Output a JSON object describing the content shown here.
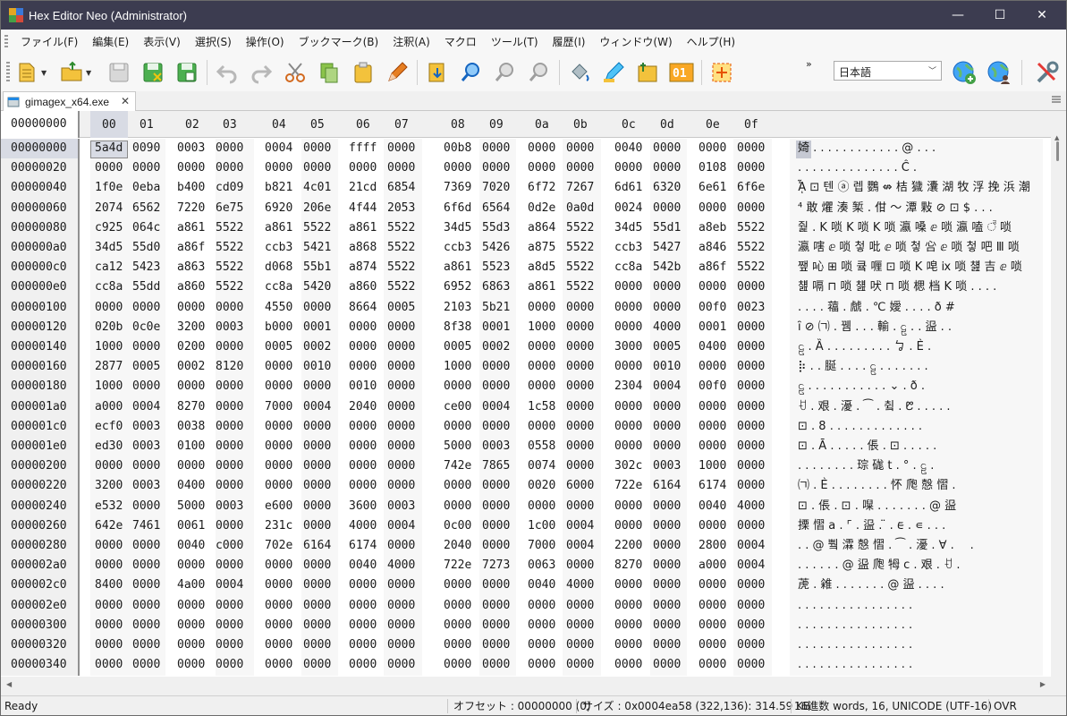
{
  "window": {
    "title": "Hex Editor Neo (Administrator)",
    "minimize": "—",
    "maximize": "☐",
    "close": "✕"
  },
  "menu": [
    "ファイル(F)",
    "編集(E)",
    "表示(V)",
    "選択(S)",
    "操作(O)",
    "ブックマーク(B)",
    "注釈(A)",
    "マクロ",
    "ツール(T)",
    "履歴(I)",
    "ウィンドウ(W)",
    "ヘルプ(H)"
  ],
  "toolbar": {
    "language": "日本語",
    "more": "»"
  },
  "tab": {
    "filename": "gimagex_x64.exe",
    "close": "✕"
  },
  "header": {
    "offset": "00000000",
    "columns": [
      "00",
      "01",
      "02",
      "03",
      "04",
      "05",
      "06",
      "07",
      "08",
      "09",
      "0a",
      "0b",
      "0c",
      "0d",
      "0e",
      "0f"
    ]
  },
  "rows": [
    {
      "off": "00000000",
      "w": [
        "5a4d",
        "0090",
        "0003",
        "0000",
        "0004",
        "0000",
        "ffff",
        "0000",
        "00b8",
        "0000",
        "0000",
        "0000",
        "0040",
        "0000",
        "0000",
        "0000"
      ],
      "a": "婍 . . . . . . . . . . . . @ . . ."
    },
    {
      "off": "00000020",
      "w": [
        "0000",
        "0000",
        "0000",
        "0000",
        "0000",
        "0000",
        "0000",
        "0000",
        "0000",
        "0000",
        "0000",
        "0000",
        "0000",
        "0000",
        "0108",
        "0000"
      ],
      "a": ". . . . . . . . . . . . . . Ĉ ."
    },
    {
      "off": "00000040",
      "w": [
        "1f0e",
        "0eba",
        "b400",
        "cd09",
        "b821",
        "4c01",
        "21cd",
        "6854",
        "7369",
        "7020",
        "6f72",
        "7267",
        "6d61",
        "6320",
        "6e61",
        "6f6e"
      ],
      "a": "ᾎ ⊡ 텐 ⓐ 렙 鸚 ⇎ 桔 獩 灢 湖 牧 浮 挽 浜 潮"
    },
    {
      "off": "00000060",
      "w": [
        "2074",
        "6562",
        "7220",
        "6e75",
        "6920",
        "206e",
        "4f44",
        "2053",
        "6f6d",
        "6564",
        "0d2e",
        "0a0d",
        "0024",
        "0000",
        "0000",
        "0000"
      ],
      "a": "⁴ 敢 爠 湊 椠 . 佄 ～ 潭 敤 ⊘ ⊡ $ . . ."
    },
    {
      "off": "00000080",
      "w": [
        "c925",
        "064c",
        "a861",
        "5522",
        "a861",
        "5522",
        "a861",
        "5522",
        "34d5",
        "55d3",
        "a864",
        "5522",
        "34d5",
        "55d1",
        "a8eb",
        "5522"
      ],
      "a": "줥 . K 唢 K 唢 K 唢 瀛 嗓 ⅇ 唢 瀛 嗑 ꣫ 唢"
    },
    {
      "off": "000000a0",
      "w": [
        "34d5",
        "55d0",
        "a86f",
        "5522",
        "ccb3",
        "5421",
        "a868",
        "5522",
        "ccb3",
        "5426",
        "a875",
        "5522",
        "ccb3",
        "5427",
        "a846",
        "5522"
      ],
      "a": "瀛 嗐 ⅇ 唢 첳 吡 ⅇ 唢 첳 吢 ⅇ 唢 첳 吧 Ⅲ 唢"
    },
    {
      "off": "000000c0",
      "w": [
        "ca12",
        "5423",
        "a863",
        "5522",
        "d068",
        "55b1",
        "a874",
        "5522",
        "a861",
        "5523",
        "a8d5",
        "5522",
        "cc8a",
        "542b",
        "a86f",
        "5522"
      ],
      "a": "쨒 吣 ⊞ 唢 큨 喱 ⊡ 唢 K 唣 ⅸ 唢 첊 吉 ⅇ 唢"
    },
    {
      "off": "000000e0",
      "w": [
        "cc8a",
        "55dd",
        "a860",
        "5522",
        "cc8a",
        "5420",
        "a860",
        "5522",
        "6952",
        "6863",
        "a861",
        "5522",
        "0000",
        "0000",
        "0000",
        "0000"
      ],
      "a": "첊 嗝 ⊓ 唢 첊 吠 ⊓ 唢 楒 档 K 唢 . . . ."
    },
    {
      "off": "00000100",
      "w": [
        "0000",
        "0000",
        "0000",
        "0000",
        "4550",
        "0000",
        "8664",
        "0005",
        "2103",
        "5b21",
        "0000",
        "0000",
        "0000",
        "0000",
        "00f0",
        "0023"
      ],
      "a": ". . . . 䕐 . 虤 . ℃ 嬡 . . . . ð #"
    },
    {
      "off": "00000120",
      "w": [
        "020b",
        "0c0e",
        "3200",
        "0003",
        "b000",
        "0001",
        "0000",
        "0000",
        "8f38",
        "0001",
        "1000",
        "0000",
        "0000",
        "4000",
        "0001",
        "0000"
      ],
      "a": "ȋ ⊘ ㈀ . 뀀 . . . 輸 . ဠ . . 䀀 . ."
    },
    {
      "off": "00000140",
      "w": [
        "1000",
        "0000",
        "0200",
        "0000",
        "0005",
        "0002",
        "0000",
        "0000",
        "0005",
        "0002",
        "0000",
        "0000",
        "3000",
        "0005",
        "0400",
        "0000"
      ],
      "a": "ဠ . Ȁ . . . . . . . . . ㆠ . Ѐ ."
    },
    {
      "off": "00000160",
      "w": [
        "2877",
        "0005",
        "0002",
        "8120",
        "0000",
        "0010",
        "0000",
        "0000",
        "1000",
        "0000",
        "0000",
        "0000",
        "0000",
        "0010",
        "0000",
        "0000"
      ],
      "a": "⡷ . . 脠 . . . . ဠ . . . . . . ."
    },
    {
      "off": "00000180",
      "w": [
        "1000",
        "0000",
        "0000",
        "0000",
        "0000",
        "0000",
        "0010",
        "0000",
        "0000",
        "0000",
        "0000",
        "0000",
        "2304",
        "0004",
        "00f0",
        "0000"
      ],
      "a": "ဠ . . . . . . . . . . . ⌄ . ð ."
    },
    {
      "off": "000001a0",
      "w": [
        "a000",
        "0004",
        "8270",
        "0000",
        "7000",
        "0004",
        "2040",
        "0000",
        "ce00",
        "0004",
        "1c58",
        "0000",
        "0000",
        "0000",
        "0000",
        "0000"
      ],
      "a": "ꀀ . 艰 . 瀀 . ⁀ . 츀 . ᱘ . . . . ."
    },
    {
      "off": "000001c0",
      "w": [
        "ecf0",
        "0003",
        "0038",
        "0000",
        "0000",
        "0000",
        "0000",
        "0000",
        "0000",
        "0000",
        "0000",
        "0000",
        "0000",
        "0000",
        "0000",
        "0000"
      ],
      "a": "⊡ . 8 . . . . . . . . . . . . ."
    },
    {
      "off": "000001e0",
      "w": [
        "ed30",
        "0003",
        "0100",
        "0000",
        "0000",
        "0000",
        "0000",
        "0000",
        "5000",
        "0003",
        "0558",
        "0000",
        "0000",
        "0000",
        "0000",
        "0000"
      ],
      "a": "⊡ . Ā . . . . . 倀 . ⊡ . . . . ."
    },
    {
      "off": "00000200",
      "w": [
        "0000",
        "0000",
        "0000",
        "0000",
        "0000",
        "0000",
        "0000",
        "0000",
        "742e",
        "7865",
        "0074",
        "0000",
        "302c",
        "0003",
        "1000",
        "0000"
      ],
      "a": ". . . . . . . . 琮 硥 t . ° . ဠ ."
    },
    {
      "off": "00000220",
      "w": [
        "3200",
        "0003",
        "0400",
        "0000",
        "0000",
        "0000",
        "0000",
        "0000",
        "0000",
        "0000",
        "0020",
        "6000",
        "722e",
        "6164",
        "6174",
        "0000"
      ],
      "a": "㈀ . Ѐ . . . . . . . . 怀 爮 慤 慴 ."
    },
    {
      "off": "00000240",
      "w": [
        "e532",
        "0000",
        "5000",
        "0003",
        "e600",
        "0000",
        "3600",
        "0003",
        "0000",
        "0000",
        "0000",
        "0000",
        "0000",
        "0000",
        "0040",
        "4000"
      ],
      "a": "⊡ . 倀 . ⊡ . 㘀 . . . . . . . @ 䀀"
    },
    {
      "off": "00000260",
      "w": [
        "642e",
        "7461",
        "0061",
        "0000",
        "231c",
        "0000",
        "4000",
        "0004",
        "0c00",
        "0000",
        "1c00",
        "0004",
        "0000",
        "0000",
        "0000",
        "0000"
      ],
      "a": "搮 慴 a . ⌜ . 䀀 . ̈ . ᰀ . ∊ . . ."
    },
    {
      "off": "00000280",
      "w": [
        "0000",
        "0000",
        "0040",
        "c000",
        "702e",
        "6164",
        "6174",
        "0000",
        "2040",
        "0000",
        "7000",
        "0004",
        "2200",
        "0000",
        "2800",
        "0004"
      ],
      "a": ". . @ 쀀 瀮 慤 慴 . ⁀ . 瀀 . ∀ . ⠀ ."
    },
    {
      "off": "000002a0",
      "w": [
        "0000",
        "0000",
        "0000",
        "0000",
        "0000",
        "0000",
        "0040",
        "4000",
        "722e",
        "7273",
        "0063",
        "0000",
        "8270",
        "0000",
        "a000",
        "0004"
      ],
      "a": ". . . . . . @ 䀀 爮 牳 c . 艰 . ꀀ ."
    },
    {
      "off": "000002c0",
      "w": [
        "8400",
        "0000",
        "4a00",
        "0004",
        "0000",
        "0000",
        "0000",
        "0000",
        "0000",
        "0000",
        "0040",
        "4000",
        "0000",
        "0000",
        "0000",
        "0000"
      ],
      "a": "萀 . 䨀 . . . . . . . @ 䀀 . . . ."
    },
    {
      "off": "000002e0",
      "w": [
        "0000",
        "0000",
        "0000",
        "0000",
        "0000",
        "0000",
        "0000",
        "0000",
        "0000",
        "0000",
        "0000",
        "0000",
        "0000",
        "0000",
        "0000",
        "0000"
      ],
      "a": ". . . . . . . . . . . . . . . ."
    },
    {
      "off": "00000300",
      "w": [
        "0000",
        "0000",
        "0000",
        "0000",
        "0000",
        "0000",
        "0000",
        "0000",
        "0000",
        "0000",
        "0000",
        "0000",
        "0000",
        "0000",
        "0000",
        "0000"
      ],
      "a": ". . . . . . . . . . . . . . . ."
    },
    {
      "off": "00000320",
      "w": [
        "0000",
        "0000",
        "0000",
        "0000",
        "0000",
        "0000",
        "0000",
        "0000",
        "0000",
        "0000",
        "0000",
        "0000",
        "0000",
        "0000",
        "0000",
        "0000"
      ],
      "a": ". . . . . . . . . . . . . . . ."
    },
    {
      "off": "00000340",
      "w": [
        "0000",
        "0000",
        "0000",
        "0000",
        "0000",
        "0000",
        "0000",
        "0000",
        "0000",
        "0000",
        "0000",
        "0000",
        "0000",
        "0000",
        "0000",
        "0000"
      ],
      "a": ". . . . . . . . . . . . . . . ."
    }
  ],
  "status": {
    "ready": "Ready",
    "offset": "オフセット : 00000000 (0)",
    "size": "サイズ : 0x0004ea58 (322,136): 314.59 KB",
    "mode": "16進数 words, 16, UNICODE (UTF-16)",
    "ovr": "OVR"
  },
  "icons": [
    "new-file-icon",
    "open-folder-icon",
    "save-icon",
    "save-as-icon",
    "save-all-icon",
    "undo-icon",
    "redo-icon",
    "cut-icon",
    "copy-icon",
    "paste-icon",
    "edit-pen-icon",
    "export-icon",
    "find-icon",
    "find-next-icon",
    "find-prev-icon",
    "fill-icon",
    "replace-icon",
    "insert-icon",
    "binary-icon",
    "select-block-icon",
    "globe-add-icon",
    "globe-user-icon",
    "settings-tools-icon"
  ]
}
